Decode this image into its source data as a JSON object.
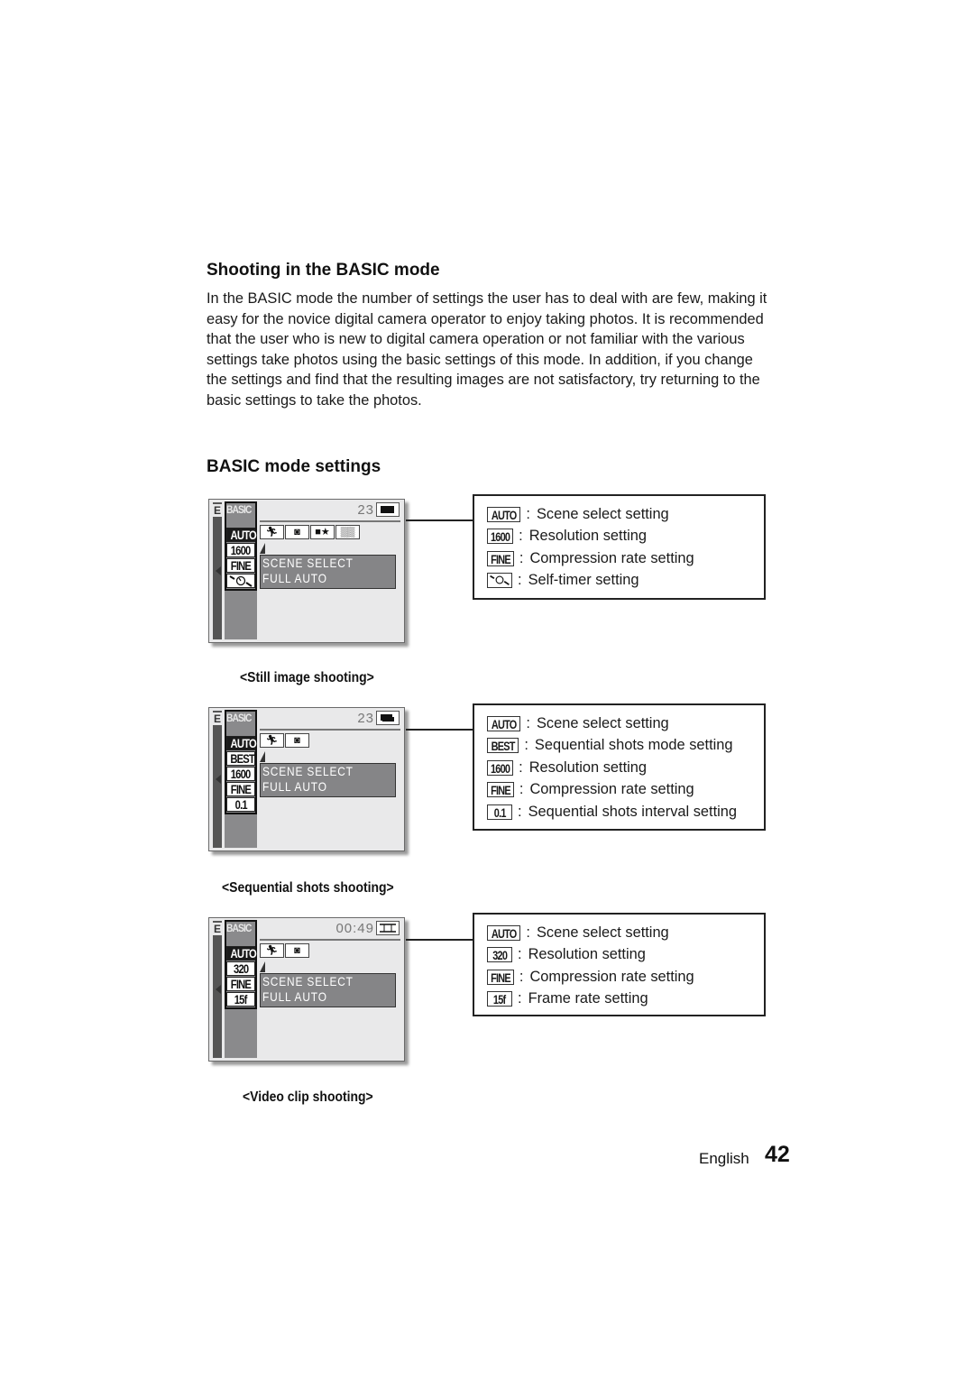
{
  "heading": "Shooting in the BASIC mode",
  "intro": "In the BASIC mode the number of settings the user has to deal with are few, making it easy for the novice digital camera operator to enjoy taking photos. It is recommended that the user who is new to digital camera operation or not familiar with the various settings take photos using the basic settings of this mode. In addition, if you change the settings and find that the resulting images are not satisfactory, try returning to the basic settings to take the photos.",
  "subheading": "BASIC mode settings",
  "panels": [
    {
      "caption": "<Still image shooting>",
      "screen": {
        "e_label": "E",
        "mode_label": "BASIC",
        "counter": "23",
        "mode_icon": "single-shot-icon",
        "column": [
          "AUTO",
          "1600",
          "FINE",
          "self-timer-icon"
        ],
        "scene_icons": [
          "sports-icon",
          "portrait-icon",
          "person-star-icon",
          "landscape-icon"
        ],
        "scene_lines": [
          "SCENE SELECT",
          "FULL AUTO"
        ]
      },
      "legend": [
        {
          "badge": "AUTO",
          "text": "Scene select setting"
        },
        {
          "badge": "1600",
          "text": "Resolution setting"
        },
        {
          "badge": "FINE",
          "text": "Compression rate setting"
        },
        {
          "badge": "self-timer-icon",
          "text": "Self-timer setting"
        }
      ]
    },
    {
      "caption": "<Sequential shots shooting>",
      "screen": {
        "e_label": "E",
        "mode_label": "BASIC",
        "counter": "23",
        "mode_icon": "sequential-shots-icon",
        "column": [
          "AUTO",
          "BEST",
          "1600",
          "FINE",
          "0.1"
        ],
        "scene_icons": [
          "sports-icon",
          "portrait-icon"
        ],
        "scene_lines": [
          "SCENE SELECT",
          "FULL AUTO"
        ]
      },
      "legend": [
        {
          "badge": "AUTO",
          "text": "Scene select setting"
        },
        {
          "badge": "BEST",
          "text": "Sequential shots mode setting"
        },
        {
          "badge": "1600",
          "text": "Resolution setting"
        },
        {
          "badge": "FINE",
          "text": "Compression rate setting"
        },
        {
          "badge": "0.1",
          "text": "Sequential shots interval setting"
        }
      ]
    },
    {
      "caption": "<Video clip shooting>",
      "screen": {
        "e_label": "E",
        "mode_label": "BASIC",
        "counter": "00:49",
        "mode_icon": "film-icon",
        "column": [
          "AUTO",
          "320",
          "FINE",
          "15f"
        ],
        "scene_icons": [
          "sports-icon",
          "portrait-icon"
        ],
        "scene_lines": [
          "SCENE SELECT",
          "FULL AUTO"
        ]
      },
      "legend": [
        {
          "badge": "AUTO",
          "text": "Scene select setting"
        },
        {
          "badge": "320",
          "text": "Resolution setting"
        },
        {
          "badge": "FINE",
          "text": "Compression rate setting"
        },
        {
          "badge": "15f",
          "text": "Frame rate setting"
        }
      ]
    }
  ],
  "footer": {
    "language": "English",
    "page": "42"
  }
}
